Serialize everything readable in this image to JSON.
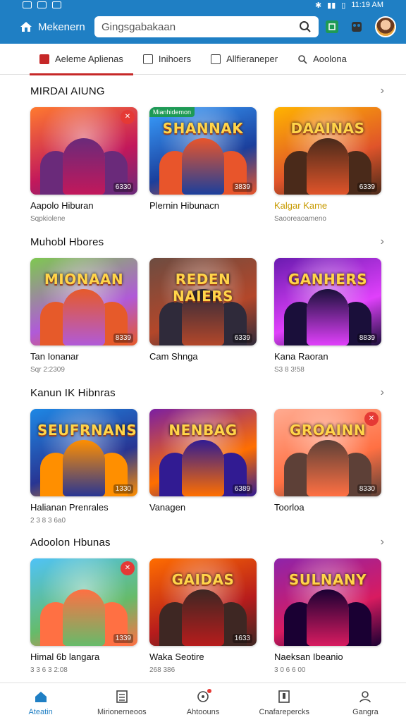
{
  "status": {
    "time": "11:19 AM"
  },
  "header": {
    "brand": "Mekenern",
    "search_placeholder": "Gingsgabakaan"
  },
  "tabs": [
    {
      "label": "Aeleme Aplienas",
      "active": true
    },
    {
      "label": "Inihoers"
    },
    {
      "label": "Allfieraneper"
    },
    {
      "label": "Aoolona"
    }
  ],
  "sections": [
    {
      "title": "MIRDAI AIUNG",
      "cards": [
        {
          "title": "Aapolo Hiburan",
          "sub": "Sqpkiolene",
          "rating": "6330",
          "logo": "",
          "theme": "orange"
        },
        {
          "title": "Plernin Hibunacn",
          "sub": "",
          "rating": "3839",
          "logo": "SHANNAK",
          "theme": "blue",
          "tag": "Mianhidemon"
        },
        {
          "title": "Kalgar Kame",
          "sub": "Saooreaoameno",
          "rating": "6339",
          "logo": "DAAINAS",
          "theme": "amber"
        }
      ]
    },
    {
      "title": "Muhobl Hbores",
      "cards": [
        {
          "title": "Tan Ionanar",
          "sub": "Sqr 2:2309",
          "rating": "8339",
          "logo": "MIONAAN",
          "theme": "green"
        },
        {
          "title": "Cam Shnga",
          "sub": "",
          "rating": "6339",
          "logo": "REDEN NAIERS",
          "theme": "brown"
        },
        {
          "title": "Kana Raoran",
          "sub": "S3 8 3!58",
          "rating": "8839",
          "logo": "GANHERS",
          "theme": "purple"
        }
      ]
    },
    {
      "title": "Kanun IK Hibnras",
      "cards": [
        {
          "title": "Halianan Prenrales",
          "sub": "2 3 8 3 6a0",
          "rating": "1330",
          "logo": "SEUFRNANS",
          "theme": "blue2"
        },
        {
          "title": "Vanagen",
          "sub": "",
          "rating": "6389",
          "logo": "NENBAG",
          "theme": "violet"
        },
        {
          "title": "Toorloa",
          "sub": "",
          "rating": "8330",
          "logo": "GROAINN",
          "theme": "peach"
        }
      ]
    },
    {
      "title": "Adoolon Hbunas",
      "cards": [
        {
          "title": "Himal 6b langara",
          "sub": "3 3 6 3 2:08",
          "rating": "1339",
          "logo": "",
          "theme": "sky"
        },
        {
          "title": "Waka Seotire",
          "sub": "268 386",
          "rating": "1633",
          "logo": "GAIDAS",
          "theme": "fire"
        },
        {
          "title": "Naeksan Ibeanio",
          "sub": "3 0 6 6 00",
          "rating": "",
          "logo": "SULNANY",
          "theme": "magenta"
        }
      ]
    }
  ],
  "nav": [
    {
      "label": "Ateatin",
      "active": true
    },
    {
      "label": "Mirionerneoos"
    },
    {
      "label": "Ahtoouns"
    },
    {
      "label": "Cnafarepercks"
    },
    {
      "label": "Gangra"
    }
  ]
}
